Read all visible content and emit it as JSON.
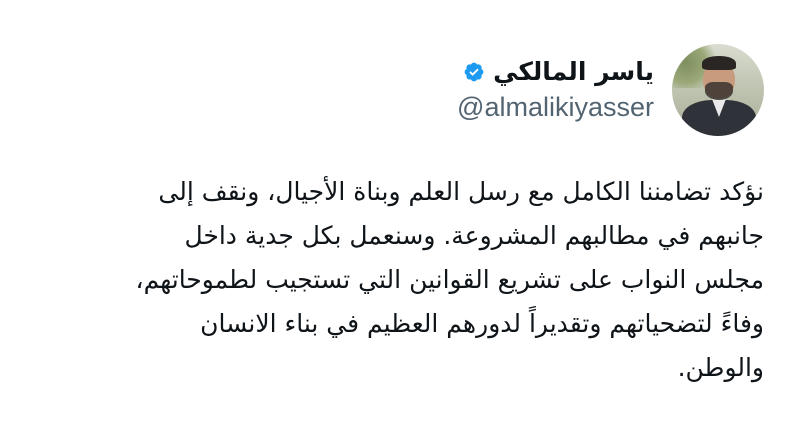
{
  "user": {
    "display_name": "ياسر المالكي",
    "handle": "@almalikiyasser",
    "verified": true,
    "verified_color": "#1d9bf0"
  },
  "tweet": {
    "lines": [
      "نؤكد تضامننا الكامل مع رسل العلم وبناة الأجيال، ونقف إلى",
      "جانبهم في مطالبهم المشروعة. وسنعمل بكل جدية داخل",
      "مجلس النواب على تشريع القوانين التي تستجيب لطموحاتهم،",
      "وفاءً لتضحياتهم وتقديراً لدورهم العظيم في بناء الانسان",
      "والوطن."
    ]
  },
  "icons": {
    "verified": "verified-badge-icon"
  }
}
